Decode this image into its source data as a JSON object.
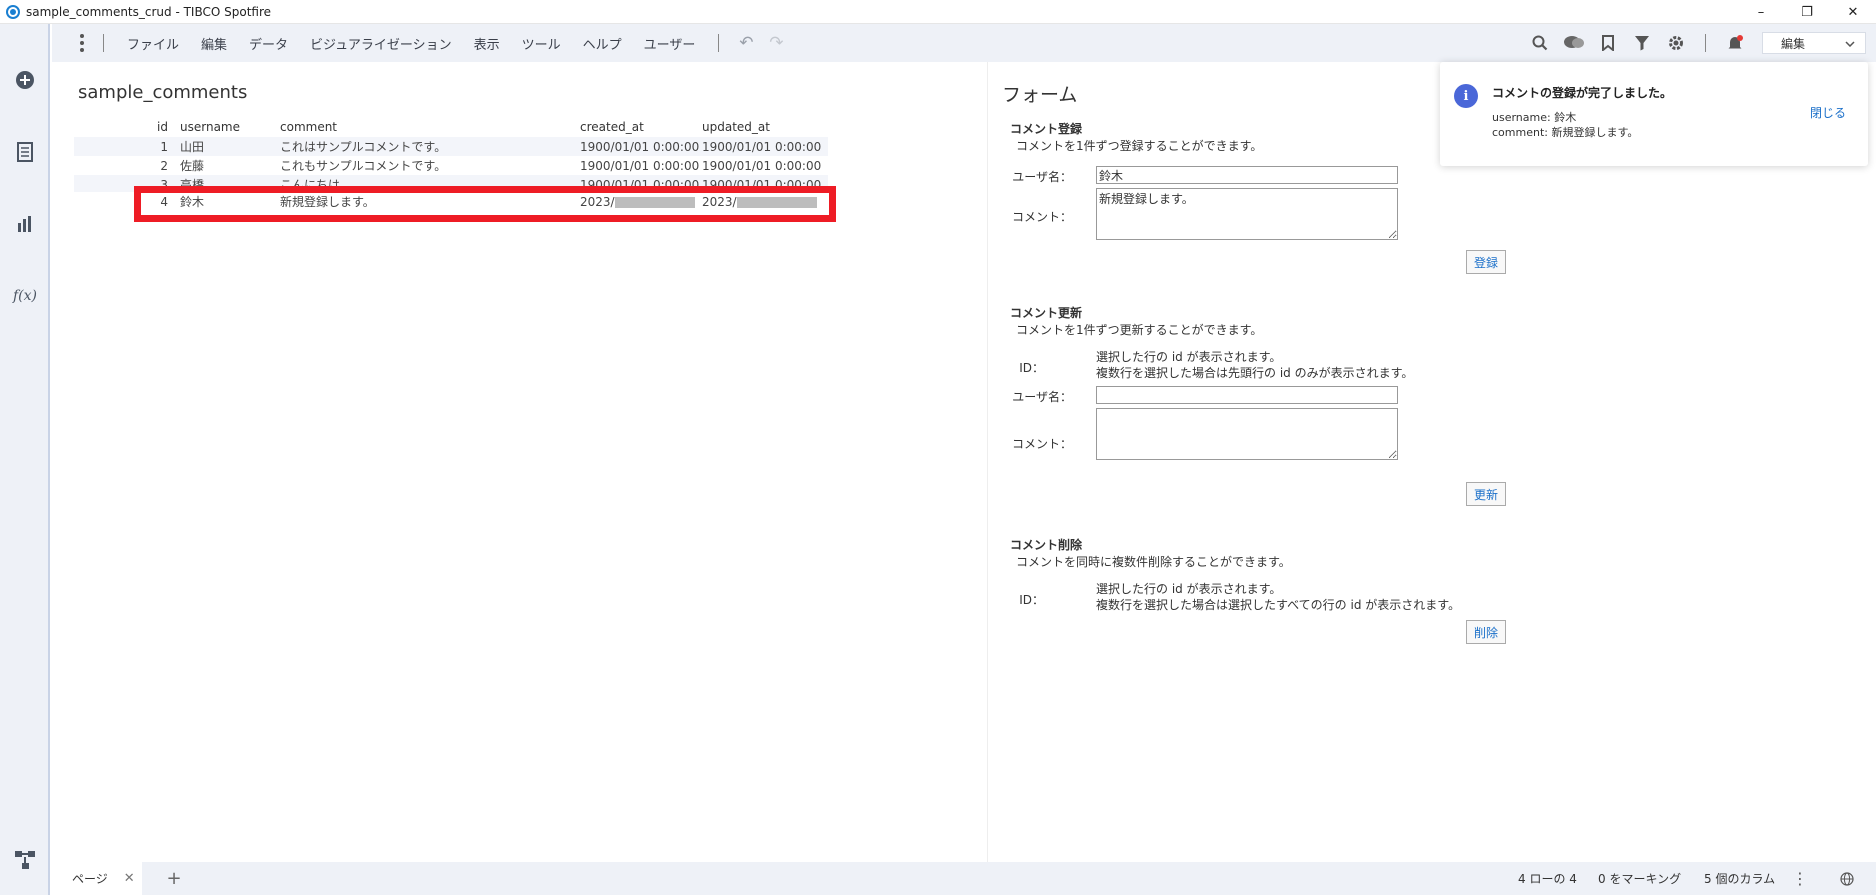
{
  "window": {
    "title": "sample_comments_crud - TIBCO Spotfire",
    "minimize": "–",
    "restore": "❐",
    "close": "✕"
  },
  "menu": {
    "items": [
      "ファイル",
      "編集",
      "データ",
      "ビジュアライゼーション",
      "表示",
      "ツール",
      "ヘルプ",
      "ユーザー"
    ],
    "mode": "編集"
  },
  "table": {
    "title": "sample_comments",
    "columns": [
      "id",
      "username",
      "comment",
      "created_at",
      "updated_at"
    ],
    "rows": [
      {
        "id": "1",
        "username": "山田",
        "comment": "これはサンプルコメントです。",
        "created_at": "1900/01/01 0:00:00",
        "updated_at": "1900/01/01 0:00:00"
      },
      {
        "id": "2",
        "username": "佐藤",
        "comment": "これもサンプルコメントです。",
        "created_at": "1900/01/01 0:00:00",
        "updated_at": "1900/01/01 0:00:00"
      },
      {
        "id": "3",
        "username": "高橋",
        "comment": "こんにちは",
        "created_at": "1900/01/01 0:00:00",
        "updated_at": "1900/01/01 0:00:00"
      },
      {
        "id": "4",
        "username": "鈴木",
        "comment": "新規登録します。",
        "created_at": "2023/",
        "updated_at": "2023/"
      }
    ]
  },
  "form": {
    "title": "フォーム",
    "register": {
      "title": "コメント登録",
      "desc": "コメントを1件ずつ登録することができます。",
      "username_label": "ユーザ名：",
      "username_value": "鈴木",
      "comment_label": "コメント：",
      "comment_value": "新規登録します。",
      "button": "登録"
    },
    "update": {
      "title": "コメント更新",
      "desc": "コメントを1件ずつ更新することができます。",
      "id_label": "ID：",
      "id_note1": "選択した行の id が表示されます。",
      "id_note2": "複数行を選択した場合は先頭行の id のみが表示されます。",
      "username_label": "ユーザ名：",
      "comment_label": "コメント：",
      "button": "更新"
    },
    "delete": {
      "title": "コメント削除",
      "desc": "コメントを同時に複数件削除することができます。",
      "id_label": "ID：",
      "id_note1": "選択した行の id が表示されます。",
      "id_note2": "複数行を選択した場合は選択したすべての行の id が表示されます。",
      "button": "削除"
    }
  },
  "toast": {
    "title": "コメントの登録が完了しました。",
    "line1": "username: 鈴木",
    "line2": "comment: 新規登録します。",
    "close": "閉じる"
  },
  "bottom": {
    "page_tab": "ページ",
    "rows_status": "4 ローの 4",
    "marking_status": "0 をマーキング",
    "columns_status": "5 個のカラム"
  }
}
